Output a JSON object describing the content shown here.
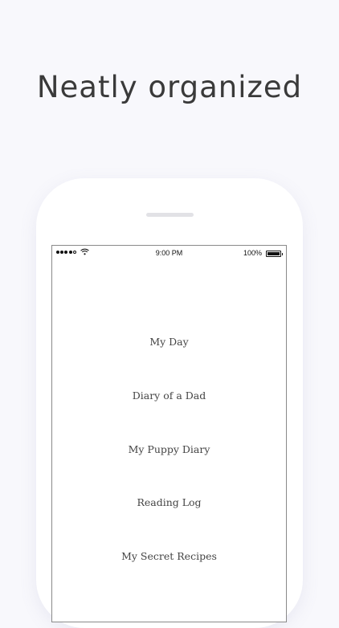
{
  "headline": "Neatly organized",
  "status_bar": {
    "time": "9:00 PM",
    "battery_percent": "100%",
    "signal_bars_filled": 4,
    "signal_bars_total": 5,
    "battery_level": 1.0
  },
  "diaries": [
    {
      "label": "My Day"
    },
    {
      "label": "Diary of a Dad"
    },
    {
      "label": "My Puppy Diary"
    },
    {
      "label": "Reading Log"
    },
    {
      "label": "My Secret Recipes"
    }
  ]
}
